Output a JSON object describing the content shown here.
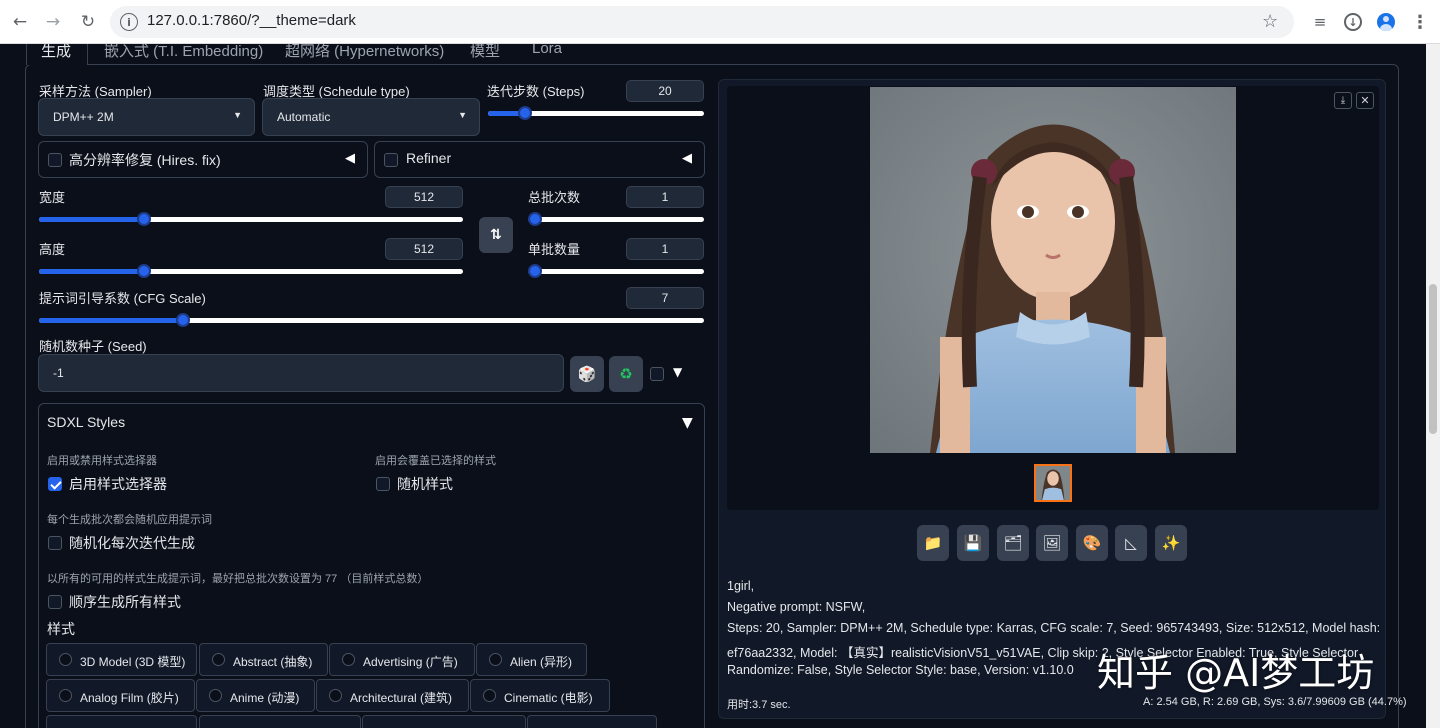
{
  "browser": {
    "url": "127.0.0.1:7860/?__theme=dark",
    "back_icon": "arrow-left-icon",
    "forward_icon": "arrow-right-icon",
    "reload_icon": "reload-icon"
  },
  "tabs": [
    {
      "label": "生成"
    },
    {
      "label": "嵌入式 (T.I. Embedding)"
    },
    {
      "label": "超网络 (Hypernetworks)"
    },
    {
      "label": "模型"
    },
    {
      "label": "Lora"
    }
  ],
  "sampler": {
    "label": "采样方法 (Sampler)",
    "value": "DPM++ 2M"
  },
  "schedule": {
    "label": "调度类型 (Schedule type)",
    "value": "Automatic"
  },
  "steps": {
    "label": "迭代步数 (Steps)",
    "value": "20",
    "fraction": 0.15
  },
  "hires": {
    "label": "高分辨率修复 (Hires. fix)"
  },
  "refiner": {
    "label": "Refiner"
  },
  "width": {
    "label": "宽度",
    "value": "512",
    "fraction": 0.24
  },
  "height": {
    "label": "高度",
    "value": "512",
    "fraction": 0.24
  },
  "batch_count": {
    "label": "总批次数",
    "value": "1",
    "fraction": 0.0
  },
  "batch_size": {
    "label": "单批数量",
    "value": "1",
    "fraction": 0.0
  },
  "swap_icon": "swap-arrows-icon",
  "cfg": {
    "label": "提示词引导系数 (CFG Scale)",
    "value": "7",
    "fraction": 0.21
  },
  "seed": {
    "label": "随机数种子 (Seed)",
    "value": "-1"
  },
  "sdxl": {
    "title": "SDXL Styles",
    "enable_hint": "启用或禁用样式选择器",
    "enable_label": "启用样式选择器",
    "random_hint": "启用会覆盖已选择的样式",
    "random_label": "随机样式",
    "each_hint": "每个生成批次都会随机应用提示词",
    "each_label": "随机化每次迭代生成",
    "all_hint": "以所有的可用的样式生成提示词，最好把总批次数设置为 77 （目前样式总数）",
    "all_label": "顺序生成所有样式",
    "styles_label": "样式",
    "styles_row1": [
      "3D Model (3D 模型)",
      "Abstract (抽象)",
      "Advertising (广告)",
      "Alien (异形)"
    ],
    "styles_row2": [
      "Analog Film (胶片)",
      "Anime (动漫)",
      "Architectural (建筑)",
      "Cinematic (电影)"
    ]
  },
  "output": {
    "prompt": "1girl,",
    "negative": "Negative prompt: NSFW,",
    "params1": "Steps: 20, Sampler: DPM++ 2M, Schedule type: Karras, CFG scale: 7, Seed: 965743493, Size: 512x512, Model hash:",
    "params2": "ef76aa2332, Model: 【真实】realisticVisionV51_v51VAE, Clip skip: 2, Style Selector Enabled: True, Style Selector",
    "params3": "Randomize: False, Style Selector Style: base, Version: v1.10.0",
    "time": "用时:3.7 sec.",
    "vram": "A: 2.54 GB, R: 2.69 GB, Sys: 3.6/7.99609 GB (44.7%)"
  },
  "watermark": "知乎 @AI梦工坊",
  "colors": {
    "accent": "#2563eb",
    "background": "#0b0f19",
    "panel": "#1f2937"
  }
}
